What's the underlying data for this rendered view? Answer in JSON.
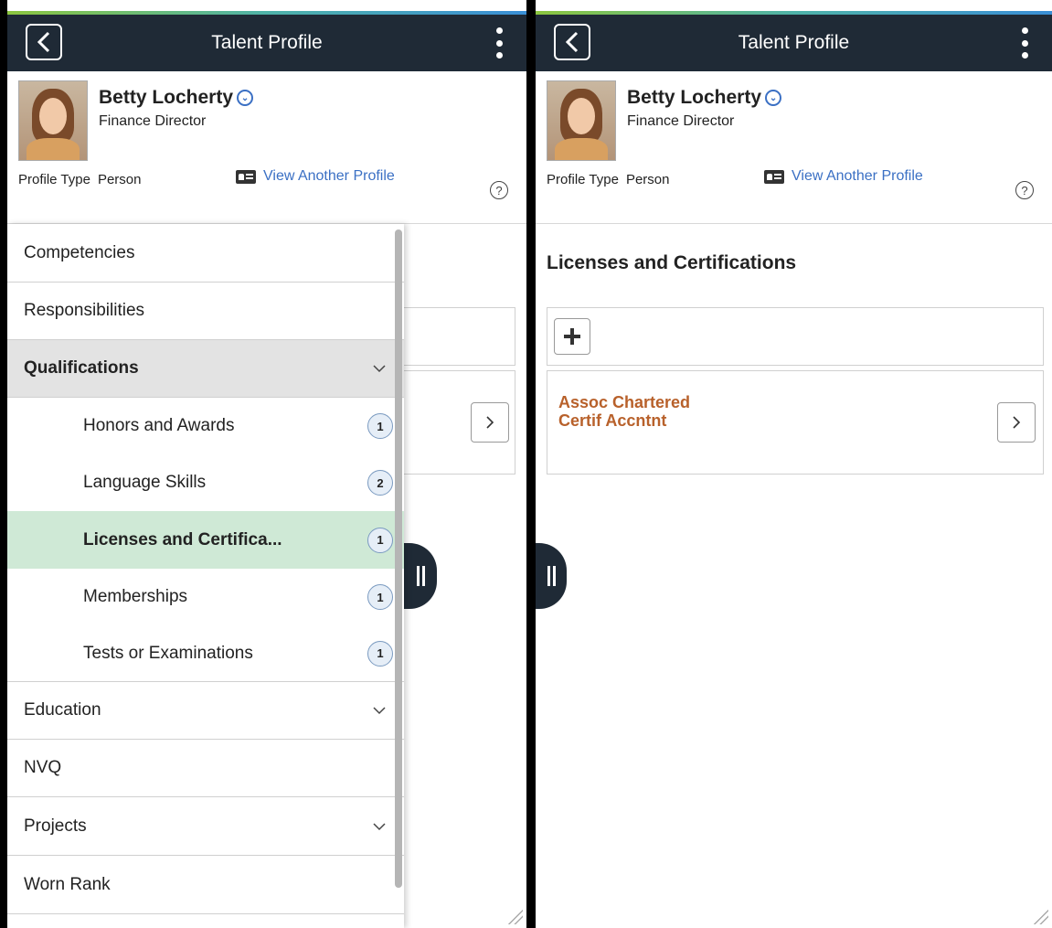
{
  "header": {
    "title": "Talent Profile"
  },
  "profile": {
    "name": "Betty Locherty",
    "job_title": "Finance Director",
    "type_label": "Profile Type",
    "type_value": "Person",
    "view_another": "View Another Profile",
    "help": "?"
  },
  "nav": {
    "items": [
      {
        "label": "Competencies"
      },
      {
        "label": "Responsibilities"
      },
      {
        "label": "Qualifications"
      },
      {
        "label": "Honors and Awards",
        "count": "1"
      },
      {
        "label": "Language Skills",
        "count": "2"
      },
      {
        "label": "Licenses and Certifica...",
        "count": "1"
      },
      {
        "label": "Memberships",
        "count": "1"
      },
      {
        "label": "Tests or Examinations",
        "count": "1"
      },
      {
        "label": "Education"
      },
      {
        "label": "NVQ"
      },
      {
        "label": "Projects"
      },
      {
        "label": "Worn Rank"
      }
    ]
  },
  "content": {
    "section_title": "Licenses and Certifications",
    "records": [
      {
        "line1": "Assoc Chartered",
        "line2": "Certif Accntnt"
      }
    ]
  },
  "colors": {
    "header_bg": "#1f2a36",
    "link": "#3b70c4",
    "record_text": "#b8612b",
    "selected_row": "#cfe9d6",
    "active_row": "#e3e3e3"
  }
}
